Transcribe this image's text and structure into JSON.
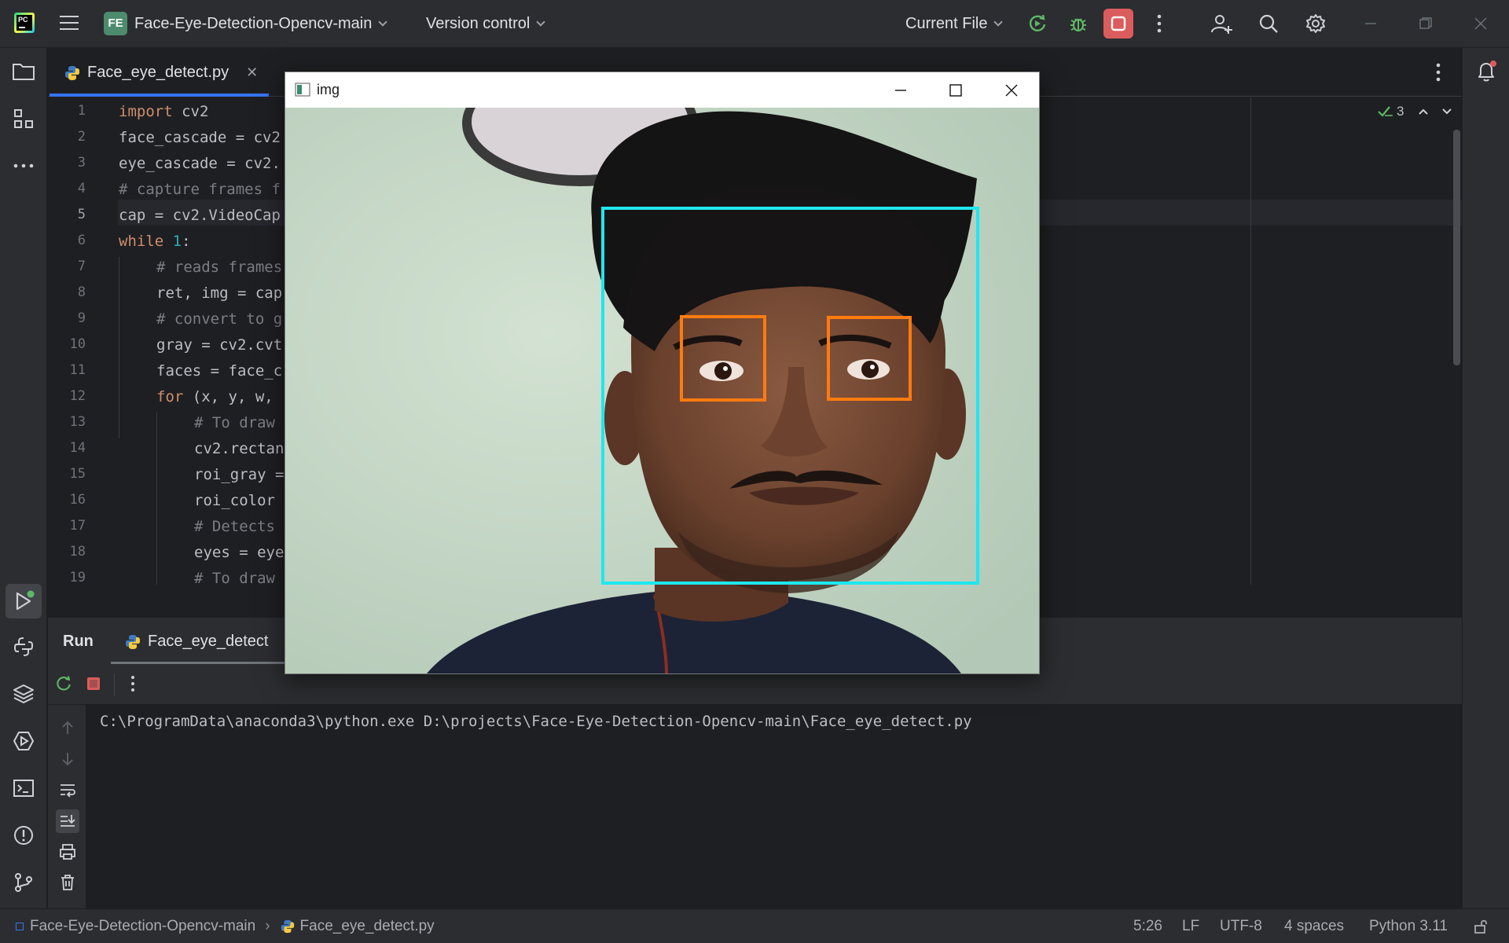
{
  "titlebar": {
    "logo_text": "PC",
    "project_badge": "FE",
    "project_name": "Face-Eye-Detection-Opencv-main",
    "vcs_label": "Version control",
    "run_config": "Current File",
    "icons": [
      "run-icon",
      "debug-icon",
      "stop-icon",
      "more-icon",
      "add-user-icon",
      "search-icon",
      "settings-icon",
      "minimize-icon",
      "restore-icon",
      "close-icon"
    ]
  },
  "left_toolbar": {
    "icons": [
      "project-folder-icon",
      "structure-icon",
      "more-tools-icon",
      "run-tool-icon",
      "python-console-icon",
      "layers-icon",
      "services-icon",
      "terminal-icon",
      "problems-icon",
      "git-icon"
    ]
  },
  "right_toolbar": {
    "icons": [
      "notifications-icon"
    ]
  },
  "editor": {
    "tab_label": "Face_eye_detect.py",
    "inspection_count": "3",
    "current_line": 5,
    "line_numbers": [
      "1",
      "2",
      "3",
      "4",
      "5",
      "6",
      "7",
      "8",
      "9",
      "10",
      "11",
      "12",
      "13",
      "14",
      "15",
      "16",
      "17",
      "18",
      "19"
    ],
    "lines": [
      {
        "indent": 0,
        "tokens": [
          {
            "t": "import",
            "c": "kw"
          },
          {
            "t": " cv2",
            "c": ""
          }
        ]
      },
      {
        "indent": 0,
        "tokens": [
          {
            "t": "face_cascade = cv2",
            "c": ""
          }
        ]
      },
      {
        "indent": 0,
        "tokens": [
          {
            "t": "eye_cascade = cv2.",
            "c": ""
          }
        ]
      },
      {
        "indent": 0,
        "tokens": [
          {
            "t": "# capture frames f",
            "c": "cm"
          }
        ]
      },
      {
        "indent": 0,
        "tokens": [
          {
            "t": "cap = cv2.VideoCap",
            "c": ""
          }
        ]
      },
      {
        "indent": 0,
        "tokens": [
          {
            "t": "while",
            "c": "kw"
          },
          {
            "t": " ",
            "c": ""
          },
          {
            "t": "1",
            "c": "num"
          },
          {
            "t": ":",
            "c": ""
          }
        ]
      },
      {
        "indent": 1,
        "tokens": [
          {
            "t": "# reads frames",
            "c": "cm"
          }
        ]
      },
      {
        "indent": 1,
        "tokens": [
          {
            "t": "ret, img = cap",
            "c": ""
          }
        ]
      },
      {
        "indent": 1,
        "tokens": [
          {
            "t": "# convert to g",
            "c": "cm"
          }
        ]
      },
      {
        "indent": 1,
        "tokens": [
          {
            "t": "gray = cv2.cvt",
            "c": ""
          }
        ]
      },
      {
        "indent": 1,
        "tokens": [
          {
            "t": "faces = face_c",
            "c": ""
          }
        ]
      },
      {
        "indent": 1,
        "tokens": [
          {
            "t": "for",
            "c": "kw"
          },
          {
            "t": " (x, y, w, ",
            "c": ""
          }
        ]
      },
      {
        "indent": 2,
        "tokens": [
          {
            "t": "# To draw",
            "c": "cm"
          }
        ]
      },
      {
        "indent": 2,
        "tokens": [
          {
            "t": "cv2.rectan",
            "c": ""
          }
        ]
      },
      {
        "indent": 2,
        "tokens": [
          {
            "t": "roi_gray =",
            "c": ""
          }
        ]
      },
      {
        "indent": 2,
        "tokens": [
          {
            "t": "roi_color",
            "c": ""
          }
        ]
      },
      {
        "indent": 2,
        "tokens": [
          {
            "t": "# Detects",
            "c": "cm"
          }
        ]
      },
      {
        "indent": 2,
        "tokens": [
          {
            "t": "eyes = eye",
            "c": ""
          }
        ]
      },
      {
        "indent": 2,
        "tokens": [
          {
            "t": "# To draw",
            "c": "cm"
          }
        ]
      }
    ]
  },
  "run_panel": {
    "title": "Run",
    "tab_label": "Face_eye_detect",
    "console_output": "C:\\ProgramData\\anaconda3\\python.exe D:\\projects\\Face-Eye-Detection-Opencv-main\\Face_eye_detect.py"
  },
  "statusbar": {
    "project": "Face-Eye-Detection-Opencv-main",
    "file": "Face_eye_detect.py",
    "position": "5:26",
    "line_sep": "LF",
    "encoding": "UTF-8",
    "indent": "4 spaces",
    "interpreter": "Python 3.11"
  },
  "cv_window": {
    "title": "img",
    "face_box_color": "#1fe7ee",
    "eye_box_color": "#ff7b10"
  },
  "colors": {
    "accent": "#3574f0",
    "run_green": "#5fb865",
    "stop_red": "#db5c5c",
    "keyword": "#cf8e6d",
    "comment": "#7a7e85",
    "number": "#2aacb8"
  }
}
